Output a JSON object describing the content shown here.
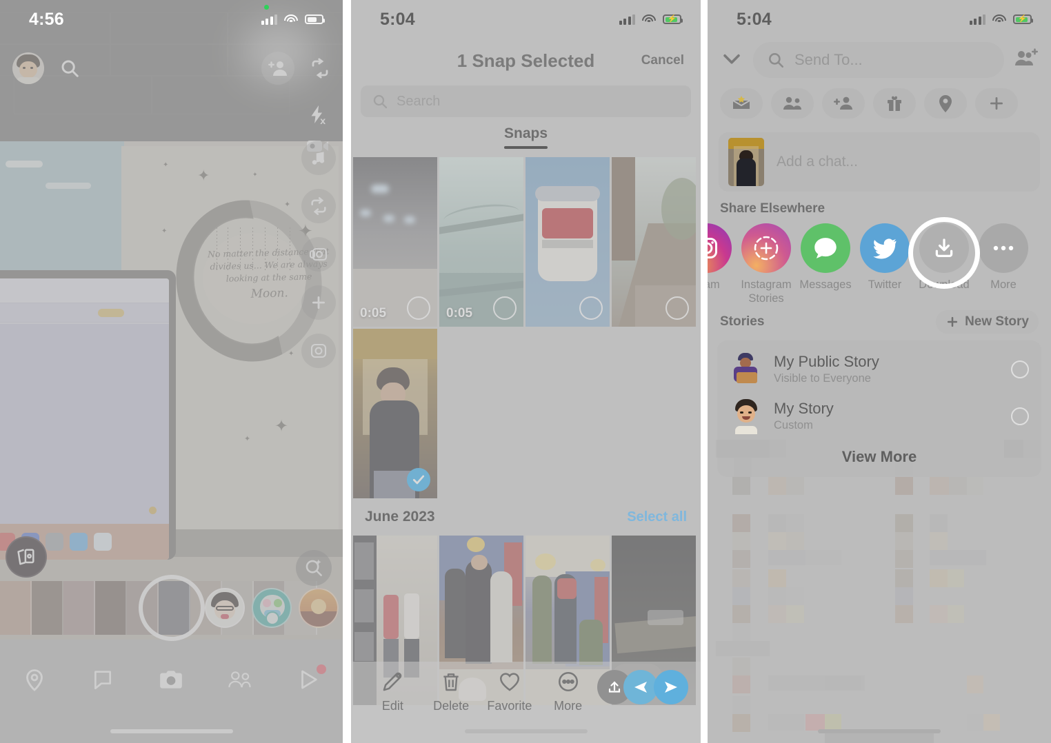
{
  "panel1": {
    "status": {
      "time": "4:56",
      "battery_charging": false,
      "recording_dot": true
    },
    "header": {
      "profile_icon": "bitmoji-avatar",
      "search_icon": "search-icon",
      "add_friend_icon": "add-friend-icon",
      "flip_camera_icon": "flip-camera-icon",
      "flash_icon": "flash-off-icon",
      "night_icon": "night-camera-icon"
    },
    "tools": [
      {
        "icon": "music-icon",
        "name": "music"
      },
      {
        "icon": "flip-icon",
        "name": "flip-camera"
      },
      {
        "icon": "timer-icon",
        "name": "timer"
      },
      {
        "icon": "plus-icon",
        "name": "more-tools"
      },
      {
        "icon": "grid-icon",
        "name": "grid"
      }
    ],
    "lens_explore_icon": "lens-explore-icon",
    "memories_icon": "memories-icon",
    "shutter_label": "shutter-button",
    "nav": [
      {
        "icon": "map-pin-icon",
        "name": "map"
      },
      {
        "icon": "chat-bubble-icon",
        "name": "chat"
      },
      {
        "icon": "camera-icon",
        "name": "camera"
      },
      {
        "icon": "friends-icon",
        "name": "stories"
      },
      {
        "icon": "play-icon",
        "name": "spotlight",
        "badge": true
      }
    ],
    "overlay_text": {
      "line1": "No matter the distance that",
      "line2": "divides us... We are always",
      "line3": "looking at the same",
      "line4": "Moon."
    }
  },
  "panel2": {
    "status": {
      "time": "5:04",
      "battery_charging": true
    },
    "title": "1 Snap Selected",
    "cancel_label": "Cancel",
    "search_placeholder": "Search",
    "search_icon": "search-icon",
    "tabs": [
      {
        "label": "Snaps",
        "active": true
      }
    ],
    "snaps": [
      {
        "duration": "0:05",
        "selected": false,
        "kind": "night-platform"
      },
      {
        "duration": "0:05",
        "selected": false,
        "kind": "bridge-river"
      },
      {
        "duration": "",
        "selected": false,
        "kind": "coffee-cup"
      },
      {
        "duration": "",
        "selected": false,
        "kind": "train-tracks"
      },
      {
        "duration": "",
        "selected": true,
        "kind": "mirror-selfie"
      }
    ],
    "section": {
      "month": "June 2023",
      "select_all_label": "Select all"
    },
    "month_photos": [
      {
        "kind": "store-aisle"
      },
      {
        "kind": "cake-cutting"
      },
      {
        "kind": "party-group"
      },
      {
        "kind": "dark-room"
      }
    ],
    "actions": [
      {
        "label": "Edit",
        "icon": "pencil-icon"
      },
      {
        "label": "Delete",
        "icon": "trash-icon"
      },
      {
        "label": "Favorite",
        "icon": "heart-icon"
      },
      {
        "label": "More",
        "icon": "ellipsis-icon"
      }
    ],
    "send_buttons": [
      {
        "name": "export-button",
        "icon": "upload-icon",
        "color": "#919191"
      },
      {
        "name": "send-chat-button",
        "icon": "paper-plane-left-icon",
        "color": "#6fb5d8"
      },
      {
        "name": "send-to-button",
        "icon": "paper-plane-right-icon",
        "color": "#5fb0dd"
      }
    ]
  },
  "panel3": {
    "status": {
      "time": "5:04",
      "battery_charging": true
    },
    "collapse_icon": "chevron-down-icon",
    "search_icon": "search-icon",
    "search_placeholder": "Send To...",
    "add_friends_icon": "add-friends-icon",
    "chips": [
      {
        "icon": "mail-star-icon",
        "name": "my-friends"
      },
      {
        "icon": "group-icon",
        "name": "groups"
      },
      {
        "icon": "add-person-icon",
        "name": "add-person"
      },
      {
        "icon": "gift-icon",
        "name": "birthdays"
      },
      {
        "icon": "location-pin-icon",
        "name": "nearby"
      },
      {
        "icon": "plus-icon",
        "name": "more"
      }
    ],
    "chat_placeholder": "Add a chat...",
    "share_header": "Share Elsewhere",
    "share_items": [
      {
        "label": "gram",
        "name": "instagram",
        "color": "#c9398f",
        "icon": "instagram-icon",
        "clipped": true
      },
      {
        "label": "Instagram\nStories",
        "name": "instagram-stories",
        "color": "#c9538f",
        "icon": "instagram-stories-icon"
      },
      {
        "label": "Messages",
        "name": "messages",
        "color": "#5fc169",
        "icon": "message-bubble-icon"
      },
      {
        "label": "Twitter",
        "name": "twitter",
        "color": "#5ca4d6",
        "icon": "twitter-bird-icon"
      },
      {
        "label": "Download",
        "name": "download",
        "color": "#adadad",
        "icon": "download-icon",
        "highlighted": true
      },
      {
        "label": "More",
        "name": "more",
        "color": "#a9a9a9",
        "icon": "ellipsis-icon"
      }
    ],
    "stories_header": "Stories",
    "new_story_label": "New Story",
    "new_story_icon": "plus-icon",
    "stories": [
      {
        "name": "My Public Story",
        "subtitle": "Visible to Everyone",
        "avatar": "bitmoji-public"
      },
      {
        "name": "My Story",
        "subtitle": "Custom",
        "avatar": "bitmoji-self"
      }
    ],
    "view_more_label": "View More"
  }
}
